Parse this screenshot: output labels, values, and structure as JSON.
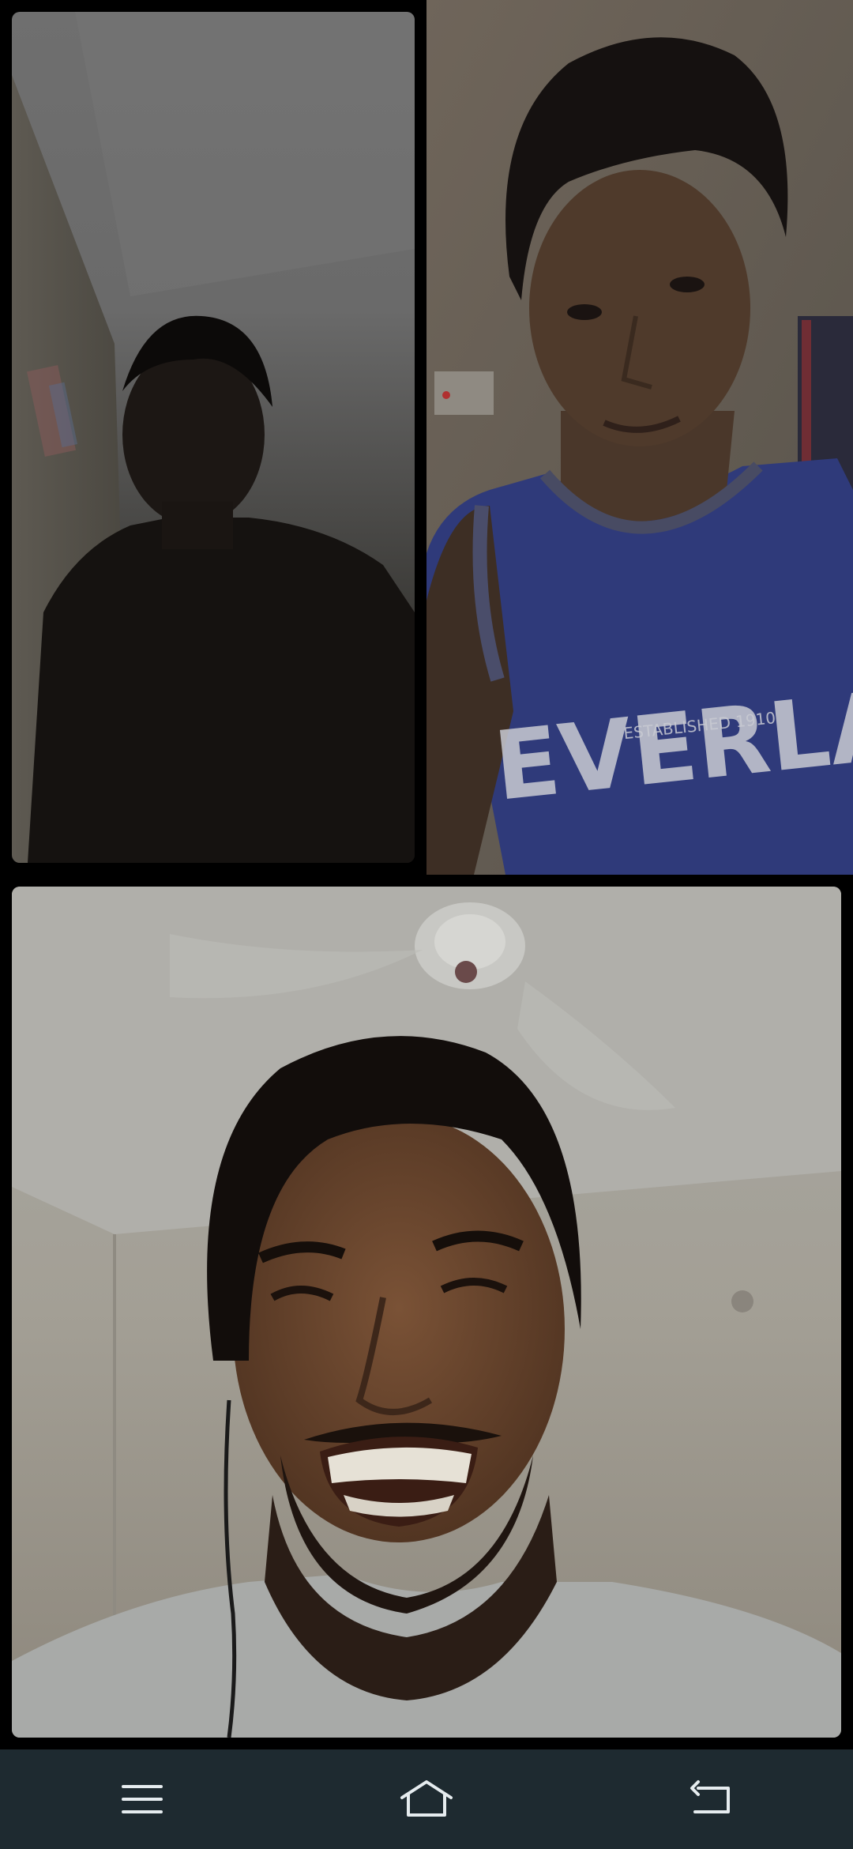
{
  "video_call": {
    "participants": [
      {
        "id": "participant-1",
        "tile": "top-left",
        "lighting": "dark"
      },
      {
        "id": "participant-2",
        "tile": "top-right",
        "shirt_print": "EVERLAST",
        "shirt_subprint": "ESTABLISHED 1910"
      },
      {
        "id": "participant-3",
        "tile": "bottom",
        "lighting": "bright"
      }
    ]
  },
  "nav_bar": {
    "buttons": [
      {
        "name": "menu",
        "icon": "menu-icon"
      },
      {
        "name": "home",
        "icon": "home-icon"
      },
      {
        "name": "back",
        "icon": "back-icon"
      }
    ],
    "background": "#1e2a30",
    "icon_color": "#e6ecef"
  }
}
